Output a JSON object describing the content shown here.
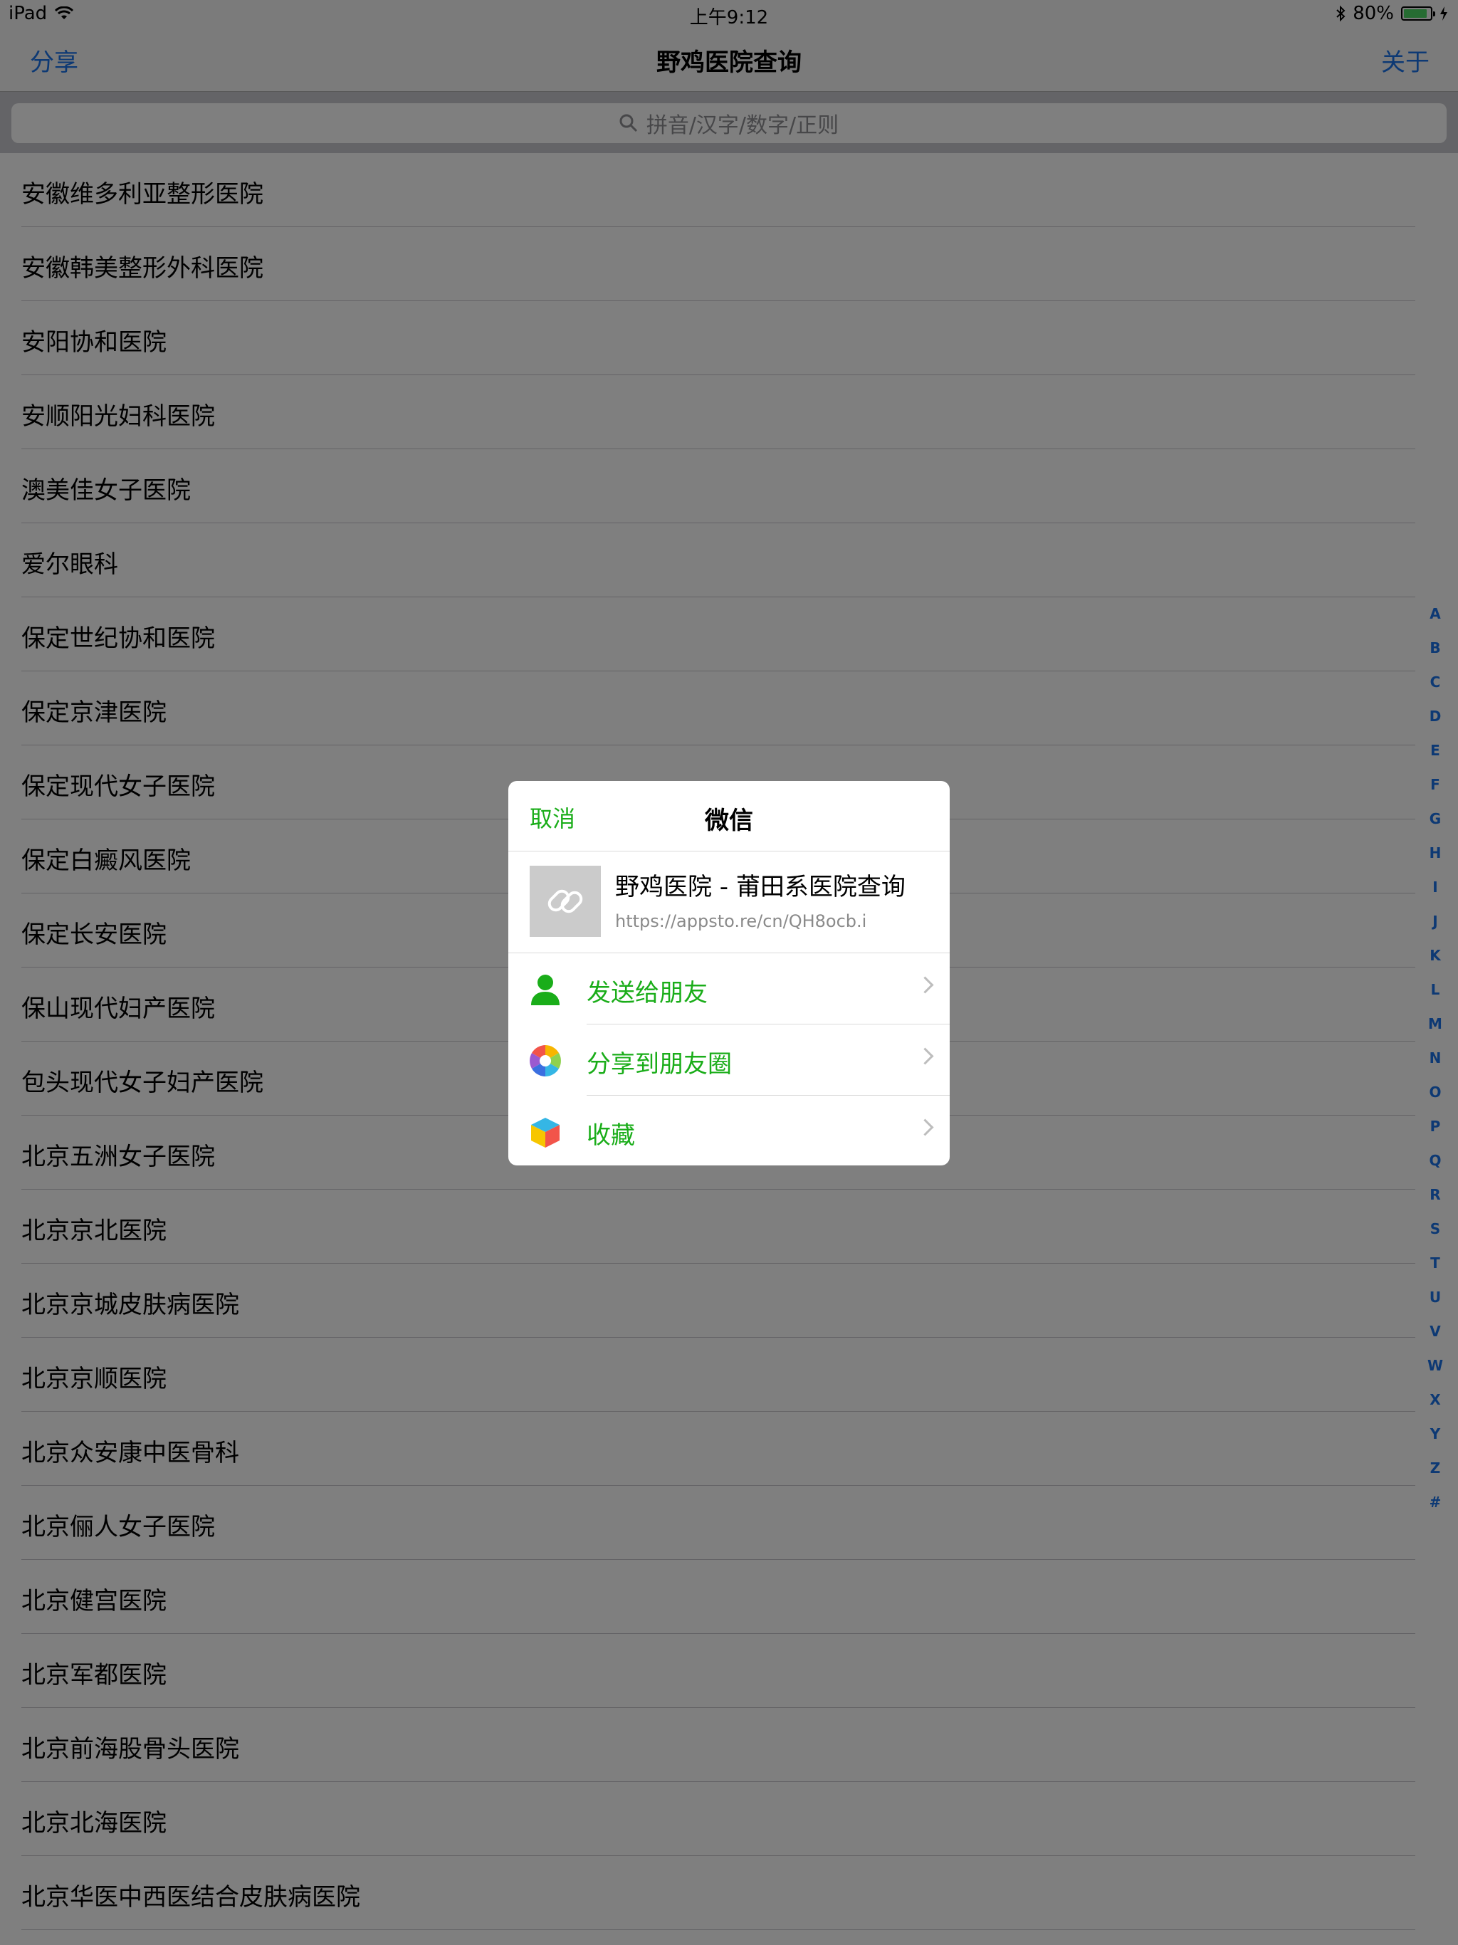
{
  "status_bar": {
    "device": "iPad",
    "time": "上午9:12",
    "battery": "80%"
  },
  "nav": {
    "left": "分享",
    "title": "野鸡医院查询",
    "right": "关于"
  },
  "search": {
    "placeholder": "拼音/汉字/数字/正则"
  },
  "list": [
    "安徽维多利亚整形医院",
    "安徽韩美整形外科医院",
    "安阳协和医院",
    "安顺阳光妇科医院",
    "澳美佳女子医院",
    "爱尔眼科",
    "保定世纪协和医院",
    "保定京津医院",
    "保定现代女子医院",
    "保定白癜风医院",
    "保定长安医院",
    "保山现代妇产医院",
    "包头现代女子妇产医院",
    "北京五洲女子医院",
    "北京京北医院",
    "北京京城皮肤病医院",
    "北京京顺医院",
    "北京众安康中医骨科",
    "北京俪人女子医院",
    "北京健宫医院",
    "北京军都医院",
    "北京前海股骨头医院",
    "北京北海医院",
    "北京华医中西医结合皮肤病医院"
  ],
  "index": [
    "A",
    "B",
    "C",
    "D",
    "E",
    "F",
    "G",
    "H",
    "I",
    "J",
    "K",
    "L",
    "M",
    "N",
    "O",
    "P",
    "Q",
    "R",
    "S",
    "T",
    "U",
    "V",
    "W",
    "X",
    "Y",
    "Z",
    "#"
  ],
  "dialog": {
    "cancel": "取消",
    "title": "微信",
    "link_title": "野鸡医院 - 莆田系医院查询",
    "link_url": "https://appsto.re/cn/QH8ocb.i",
    "items": [
      {
        "label": "发送给朋友",
        "icon": "person-icon"
      },
      {
        "label": "分享到朋友圈",
        "icon": "moments-icon"
      },
      {
        "label": "收藏",
        "icon": "favorites-cube-icon"
      }
    ]
  },
  "colors": {
    "accent_blue": "#1a73e8",
    "wechat_green": "#1aad19",
    "battery_green": "#4cd964"
  }
}
